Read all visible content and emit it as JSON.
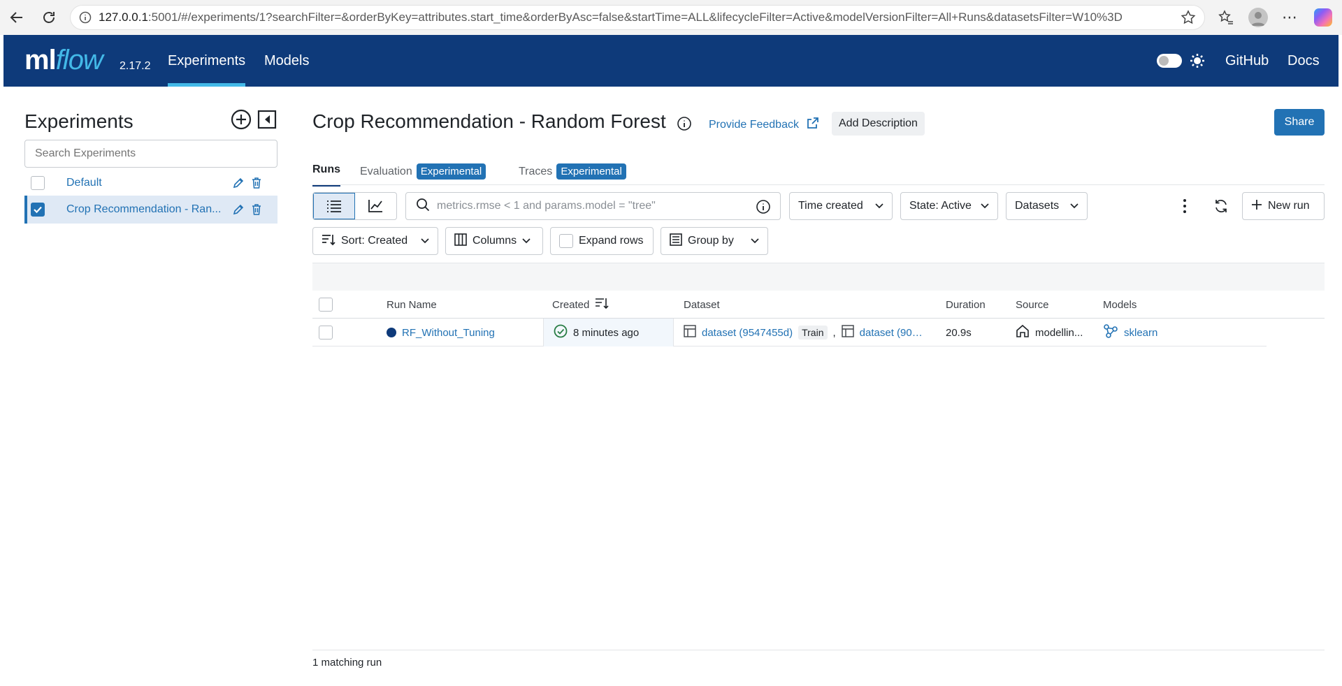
{
  "browser": {
    "url_host": "127.0.0.1",
    "url_path": ":5001/#/experiments/1?searchFilter=&orderByKey=attributes.start_time&orderByAsc=false&startTime=ALL&lifecycleFilter=Active&modelVersionFilter=All+Runs&datasetsFilter=W10%3D"
  },
  "header": {
    "logo_ml": "ml",
    "logo_flow": "flow",
    "version": "2.17.2",
    "tabs": [
      {
        "label": "Experiments"
      },
      {
        "label": "Models"
      }
    ],
    "github": "GitHub",
    "docs": "Docs"
  },
  "sidebar": {
    "title": "Experiments",
    "search_placeholder": "Search Experiments",
    "items": [
      {
        "label": "Default"
      },
      {
        "label": "Crop Recommendation - Ran..."
      }
    ]
  },
  "main": {
    "title": "Crop Recommendation - Random Forest",
    "feedback": "Provide Feedback",
    "add_description": "Add Description",
    "share": "Share",
    "tabs": [
      {
        "label": "Runs"
      },
      {
        "label": "Evaluation",
        "badge": "Experimental"
      },
      {
        "label": "Traces",
        "badge": "Experimental"
      }
    ]
  },
  "toolbar": {
    "search_placeholder": "metrics.rmse < 1 and params.model = \"tree\"",
    "time_created": "Time created",
    "state": "State: Active",
    "datasets": "Datasets",
    "new_run": "New run",
    "sort": "Sort: Created",
    "columns": "Columns",
    "expand_rows": "Expand rows",
    "group_by": "Group by"
  },
  "table": {
    "headers": [
      "Run Name",
      "Created",
      "Dataset",
      "Duration",
      "Source",
      "Models"
    ],
    "rows": [
      {
        "run_name": "RF_Without_Tuning",
        "created": "8 minutes ago",
        "dataset1": "dataset (9547455d)",
        "dataset_tag": "Train",
        "dataset2": "dataset (90…",
        "duration": "20.9s",
        "source": "modellin...",
        "model": "sklearn"
      }
    ]
  },
  "footer": {
    "matching": "1 matching run"
  },
  "colors": {
    "header_bg": "#0e3a7a",
    "accent": "#2272b4",
    "tab_underline": "#43b9e8"
  }
}
